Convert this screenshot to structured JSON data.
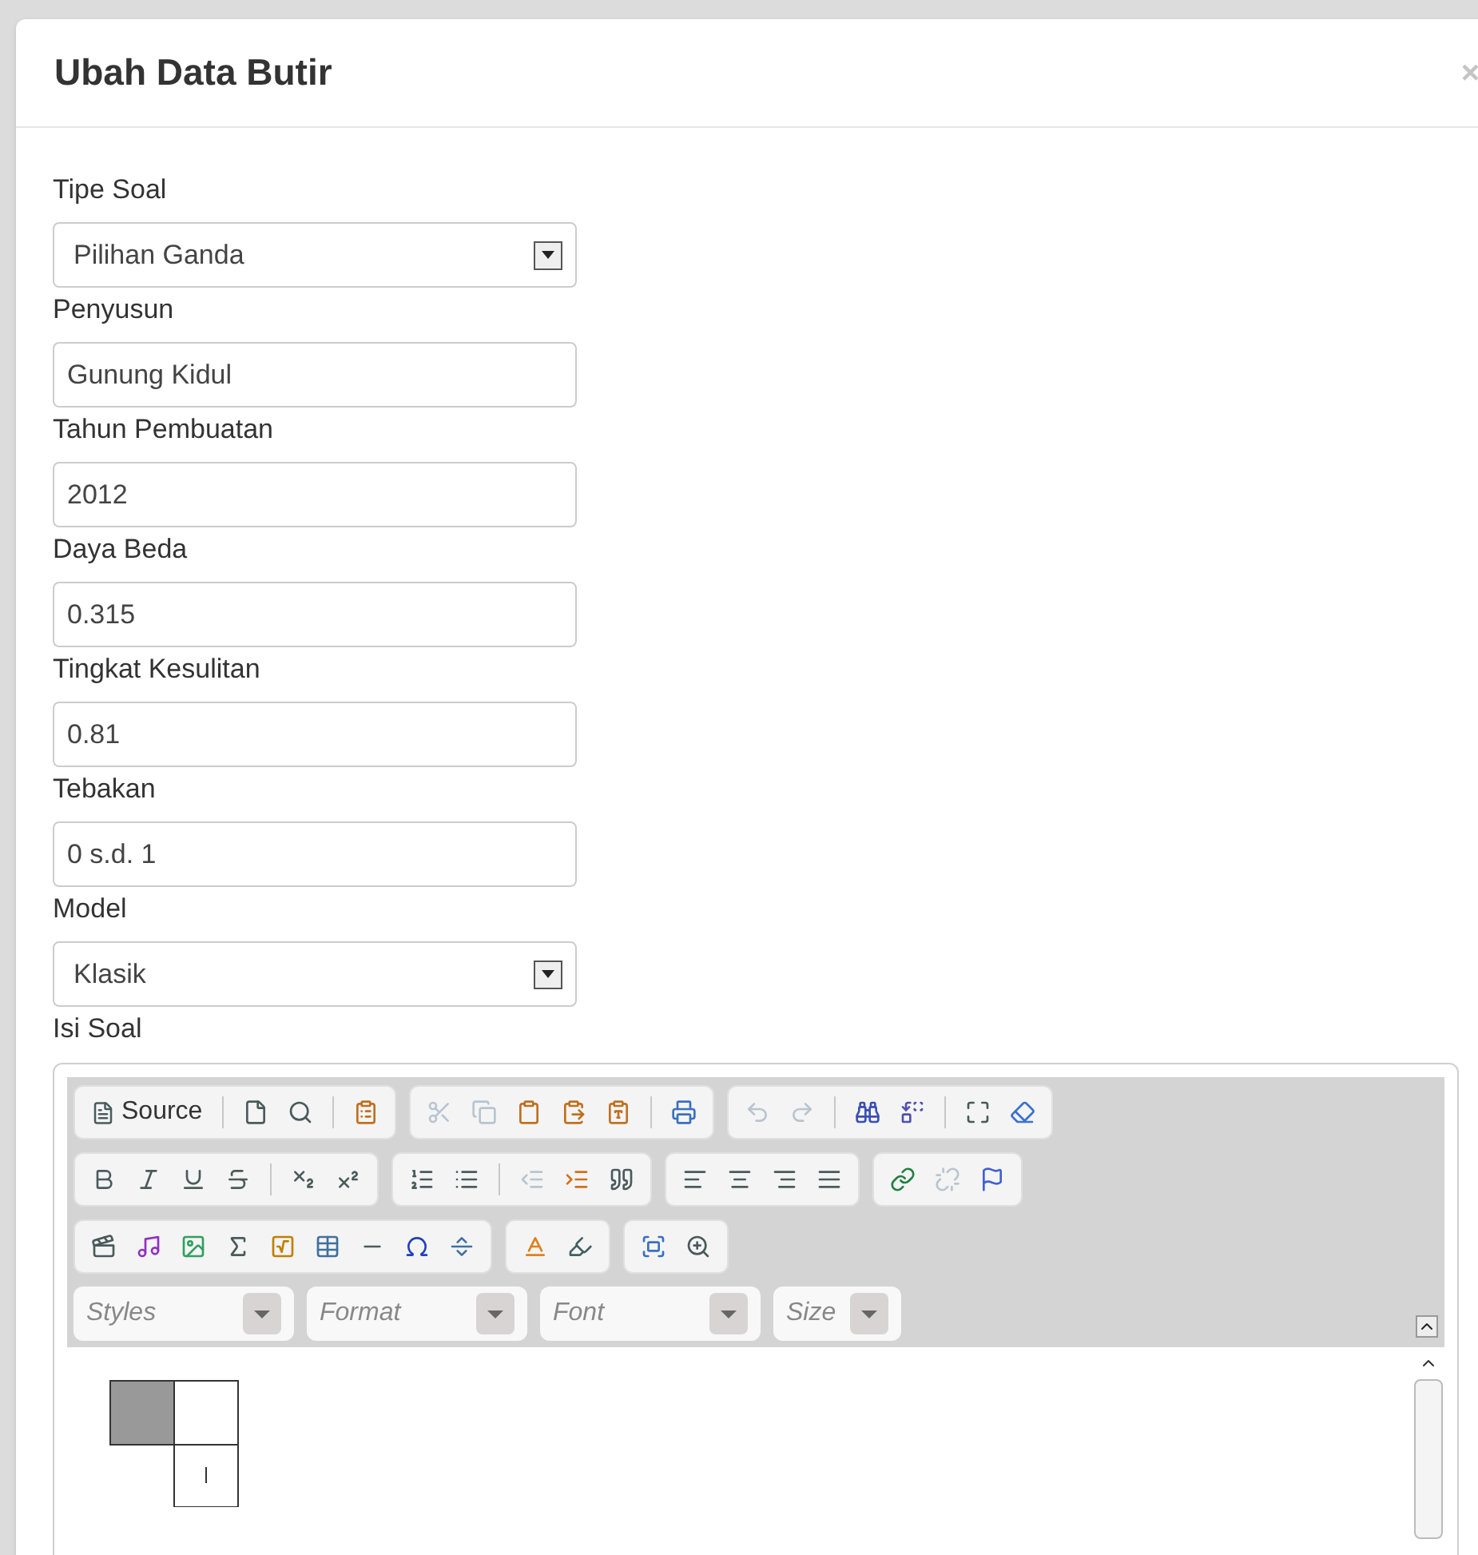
{
  "dialog": {
    "title": "Ubah Data Butir",
    "close": "×"
  },
  "fields": [
    {
      "label": "Tipe Soal",
      "kind": "select",
      "value": "Pilihan Ganda"
    },
    {
      "label": "Penyusun",
      "kind": "text",
      "value": "Gunung Kidul"
    },
    {
      "label": "Tahun Pembuatan",
      "kind": "text",
      "value": "2012"
    },
    {
      "label": "Daya Beda",
      "kind": "text",
      "value": "0.315"
    },
    {
      "label": "Tingkat Kesulitan",
      "kind": "text",
      "value": "0.81"
    },
    {
      "label": "Tebakan",
      "kind": "text",
      "value": "0 s.d. 1"
    },
    {
      "label": "Model",
      "kind": "select",
      "value": "Klasik"
    }
  ],
  "editor": {
    "label": "Isi Soal",
    "source_button": "Source",
    "combos": [
      {
        "placeholder": "Styles"
      },
      {
        "placeholder": "Format"
      },
      {
        "placeholder": "Font"
      },
      {
        "placeholder": "Size"
      }
    ]
  }
}
